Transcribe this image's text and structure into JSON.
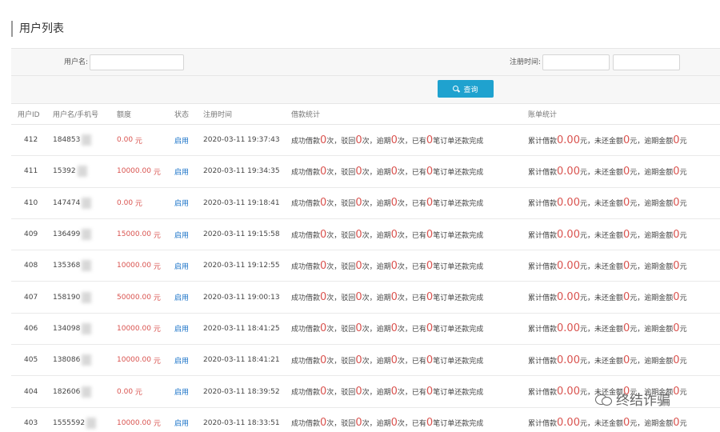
{
  "page": {
    "title": "用户列表"
  },
  "filters": {
    "username_label": "用户名:",
    "username_value": "",
    "register_time_label": "注册时间:",
    "date_from": "",
    "date_to": "",
    "search_label": "查询"
  },
  "table": {
    "headers": [
      "用户ID",
      "用户名/手机号",
      "额度",
      "状态",
      "注册时间",
      "借款统计",
      "账单统计"
    ],
    "rows": [
      {
        "id": "412",
        "user": "184853",
        "limit": "0.00",
        "unit": "元",
        "status": "启用",
        "time": "2020-03-11 19:37:43"
      },
      {
        "id": "411",
        "user": "15392",
        "limit": "10000.00",
        "unit": "元",
        "status": "启用",
        "time": "2020-03-11 19:34:35"
      },
      {
        "id": "410",
        "user": "147474",
        "limit": "0.00",
        "unit": "元",
        "status": "启用",
        "time": "2020-03-11 19:18:41"
      },
      {
        "id": "409",
        "user": "136499",
        "limit": "15000.00",
        "unit": "元",
        "status": "启用",
        "time": "2020-03-11 19:15:58"
      },
      {
        "id": "408",
        "user": "135368",
        "limit": "10000.00",
        "unit": "元",
        "status": "启用",
        "time": "2020-03-11 19:12:55"
      },
      {
        "id": "407",
        "user": "158190",
        "limit": "50000.00",
        "unit": "元",
        "status": "启用",
        "time": "2020-03-11 19:00:13"
      },
      {
        "id": "406",
        "user": "134098",
        "limit": "10000.00",
        "unit": "元",
        "status": "启用",
        "time": "2020-03-11 18:41:25"
      },
      {
        "id": "405",
        "user": "138086",
        "limit": "10000.00",
        "unit": "元",
        "status": "启用",
        "time": "2020-03-11 18:41:21"
      },
      {
        "id": "404",
        "user": "182606",
        "limit": "0.00",
        "unit": "元",
        "status": "启用",
        "time": "2020-03-11 18:39:52"
      },
      {
        "id": "403",
        "user": "1555592",
        "limit": "10000.00",
        "unit": "元",
        "status": "启用",
        "time": "2020-03-11 18:33:51"
      }
    ],
    "loan_stats": {
      "p1": "成功借款",
      "v1": "0",
      "p2": "次，驳回",
      "v2": "0",
      "p3": "次，逾期",
      "v3": "0",
      "p4": "次，已有",
      "v4": "0",
      "p5": "笔订单还款完成"
    },
    "bill_stats": {
      "p1": "累计借款",
      "v1": "0.00",
      "p2": "元，未还金额",
      "v2": "0",
      "p3": "元，逾期金额",
      "v3": "0",
      "p4": "元"
    }
  },
  "watermark": {
    "text": "终结诈骗",
    "icon": "wechat-icon"
  },
  "colors": {
    "accent": "#1fa2cf",
    "amount": "#d9534f",
    "status": "#1a73c8"
  }
}
